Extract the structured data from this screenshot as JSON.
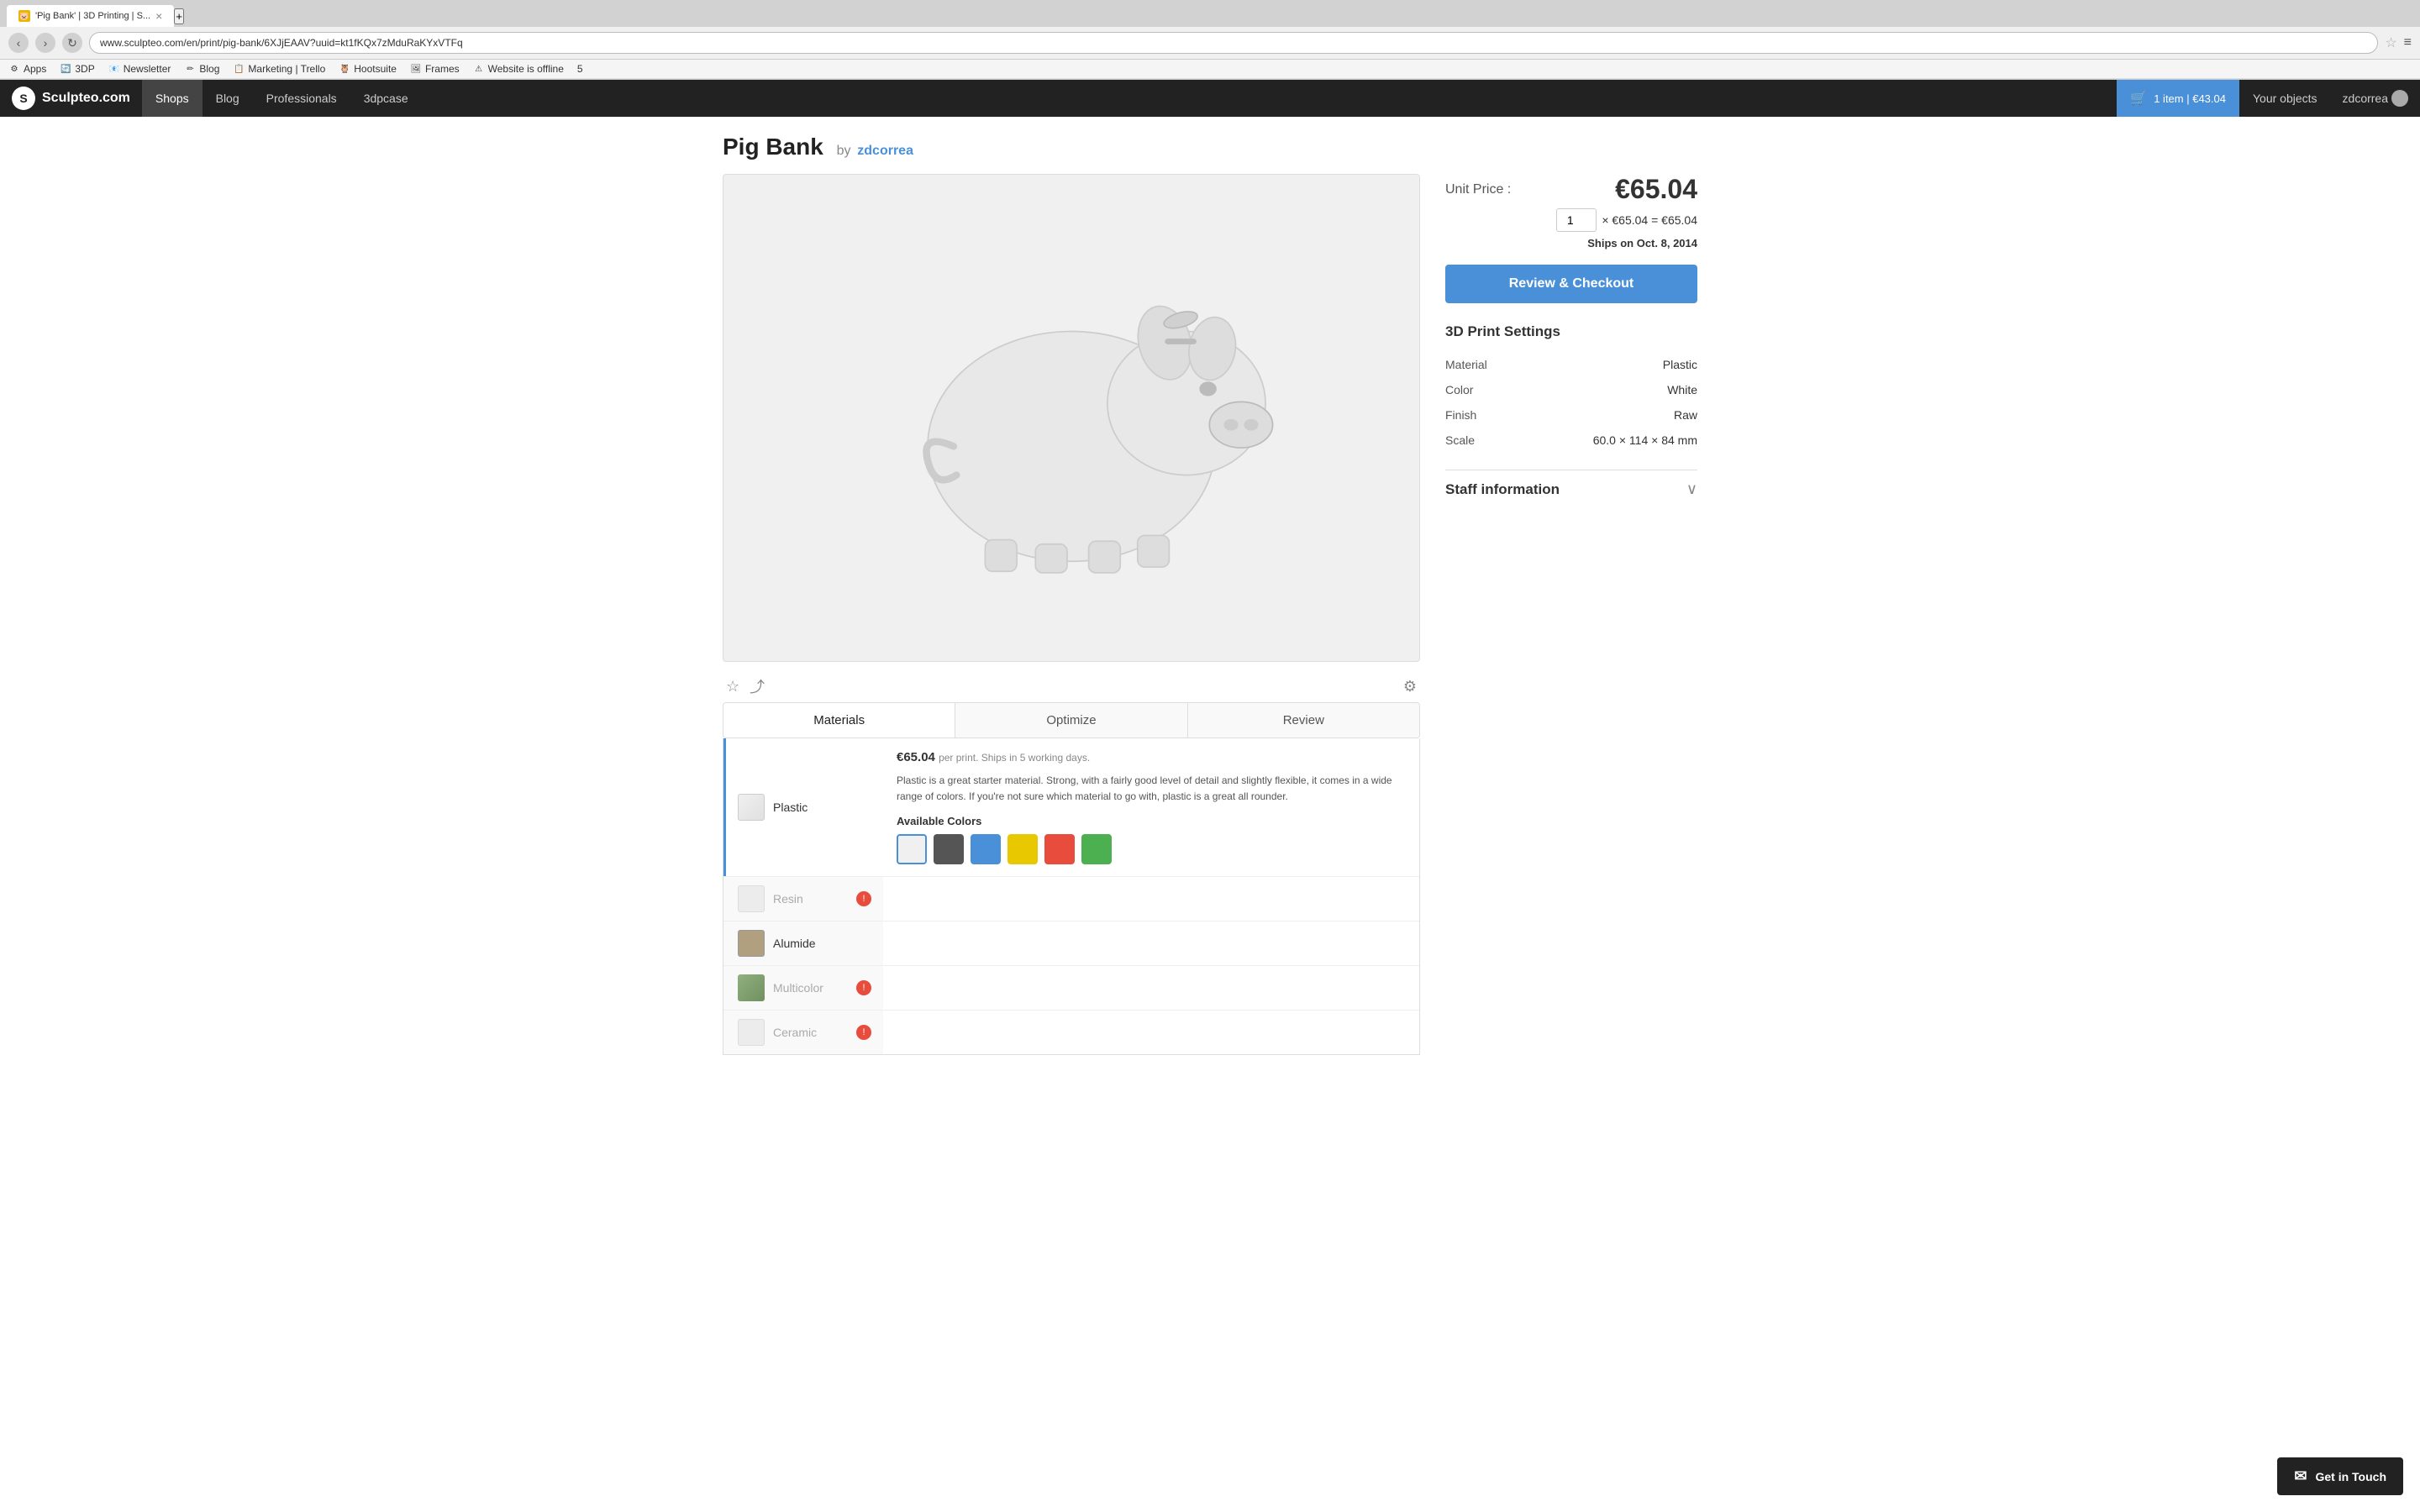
{
  "browser": {
    "tab_title": "'Pig Bank' | 3D Printing | S...",
    "address": "www.sculpteo.com/en/print/pig-bank/6XJjEAAV?uuid=kt1fKQx7zMduRaKYxVTFq",
    "bookmarks": [
      {
        "label": "Apps",
        "icon": "⚙"
      },
      {
        "label": "3DP",
        "icon": "🔄"
      },
      {
        "label": "Newsletter",
        "icon": "📧"
      },
      {
        "label": "Blog",
        "icon": "✏"
      },
      {
        "label": "Marketing | Trello",
        "icon": "📋"
      },
      {
        "label": "Hootsuite",
        "icon": "🦉"
      },
      {
        "label": "Frames",
        "icon": "🖼"
      },
      {
        "label": "Website is offline",
        "icon": "⚠"
      },
      {
        "label": "5",
        "icon": ""
      }
    ]
  },
  "site_nav": {
    "logo_text": "Sculpteo.com",
    "links": [
      "Shops",
      "Blog",
      "Professionals",
      "3dpcase"
    ],
    "cart_label": "1 item | €43.04",
    "your_objects": "Your objects",
    "username": "zdcorrea"
  },
  "product": {
    "title": "Pig Bank",
    "by_label": "by",
    "author": "zdcorrea",
    "unit_price_label": "Unit Price :",
    "unit_price": "€65.04",
    "quantity": "1",
    "price_calc": "× €65.04 = €65.04",
    "ships_date": "Ships on Oct. 8, 2014",
    "checkout_button": "Review & Checkout",
    "print_settings_title": "3D Print Settings",
    "settings": [
      {
        "label": "Material",
        "value": "Plastic"
      },
      {
        "label": "Color",
        "value": "White"
      },
      {
        "label": "Finish",
        "value": "Raw"
      }
    ],
    "scale_label": "Scale",
    "scale_x": "60.0",
    "scale_x_sym": "×",
    "scale_y": "114",
    "scale_y_sym": "×",
    "scale_z": "84",
    "scale_unit": "mm",
    "staff_info_title": "Staff information",
    "tabs": [
      "Materials",
      "Optimize",
      "Review"
    ],
    "active_tab": "Materials"
  },
  "materials": {
    "active": "Plastic",
    "list": [
      {
        "name": "Plastic",
        "type": "plastic",
        "disabled": false,
        "error": false
      },
      {
        "name": "Resin",
        "type": "none",
        "disabled": true,
        "error": true
      },
      {
        "name": "Alumide",
        "type": "alumide",
        "disabled": false,
        "error": false
      },
      {
        "name": "Multicolor",
        "type": "multicolor",
        "disabled": true,
        "error": true
      },
      {
        "name": "Ceramic",
        "type": "none",
        "disabled": true,
        "error": true
      }
    ],
    "active_price": "€65.04",
    "active_ships": "per print. Ships in 5 working days.",
    "active_desc": "Plastic is a great starter material. Strong, with a fairly good level of detail and slightly flexible, it comes in a wide range of colors. If you're not sure which material to go with, plastic is a great all rounder.",
    "colors_label": "Available Colors",
    "colors": [
      {
        "hex": "#f0f0f0",
        "name": "white",
        "selected": true
      },
      {
        "hex": "#555555",
        "name": "dark-gray",
        "selected": false
      },
      {
        "hex": "#4a90d9",
        "name": "blue",
        "selected": false
      },
      {
        "hex": "#e8c800",
        "name": "yellow",
        "selected": false
      },
      {
        "hex": "#e74c3c",
        "name": "red",
        "selected": false
      },
      {
        "hex": "#4caf50",
        "name": "green",
        "selected": false
      }
    ]
  },
  "get_in_touch": {
    "label": "Get in Touch",
    "icon": "✉"
  }
}
